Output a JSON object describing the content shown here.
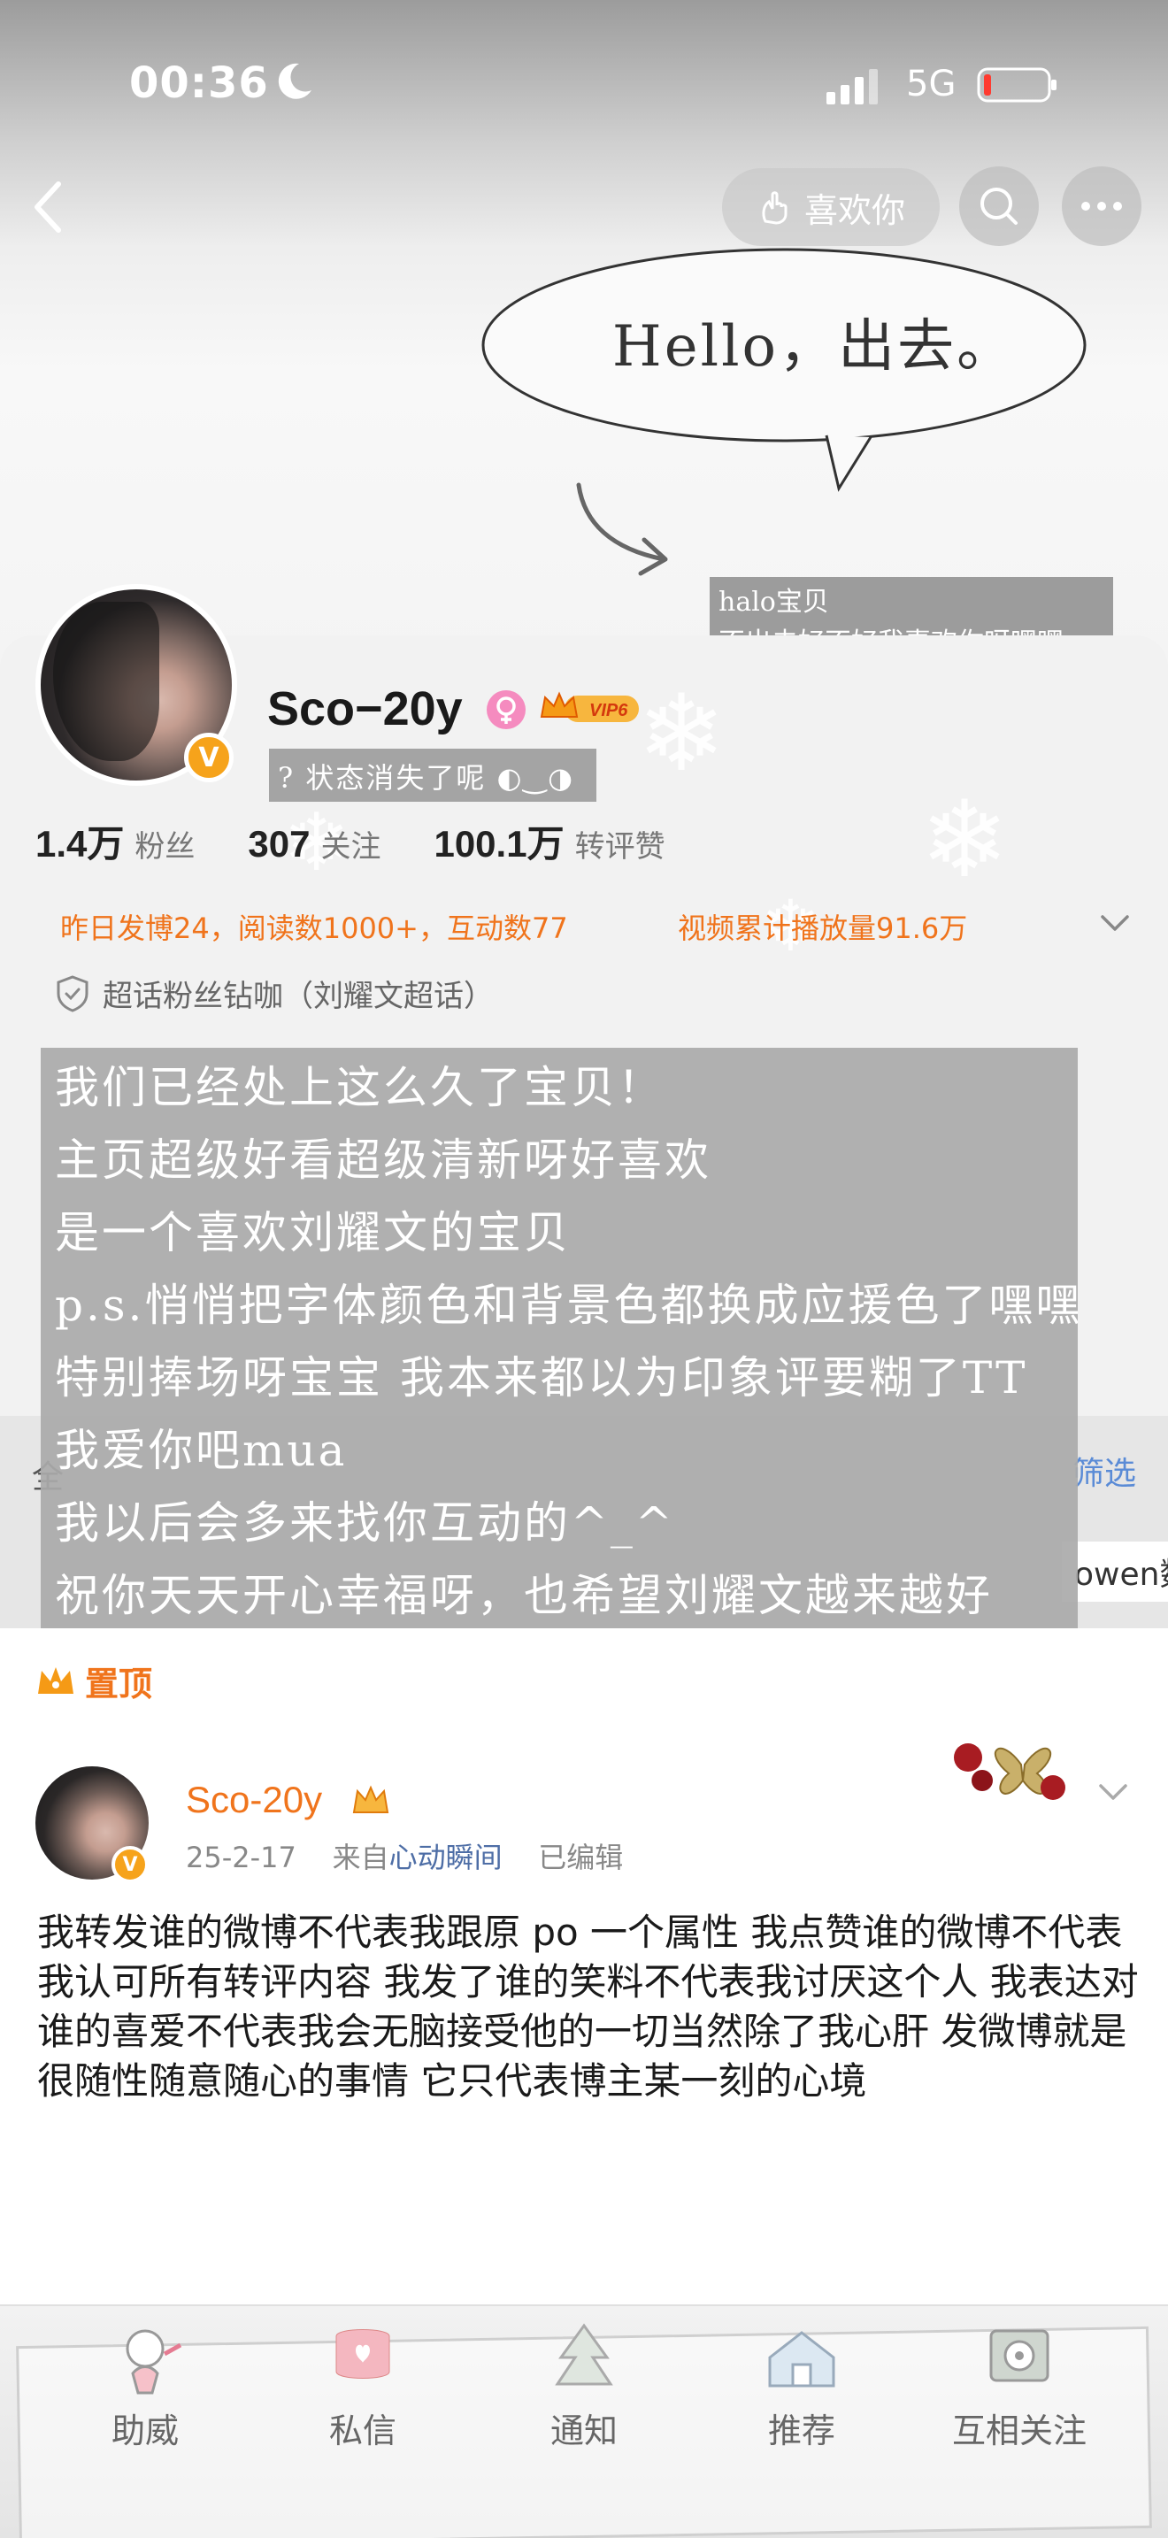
{
  "status_bar": {
    "time": "00:36",
    "network": "5G"
  },
  "header": {
    "like_button": "喜欢你"
  },
  "banner": {
    "bubble_text": "Hello，出去。",
    "note_line1": "halo宝贝",
    "note_line2": "不出去好不好我喜欢你呀嘿嘿"
  },
  "profile": {
    "username": "Sco−20y",
    "vip_label": "VIP6",
    "status_tag": "? 状态消失了呢 ◐‿◑",
    "stats": [
      {
        "num": "1.4万",
        "label": "粉丝"
      },
      {
        "num": "307",
        "label": "关注"
      },
      {
        "num": "100.1万",
        "label": "转评赞"
      }
    ],
    "activity": "昨日发博24，阅读数1000+，互动数77",
    "video_plays": "视频累计播放量91.6万",
    "super_topic": "超话粉丝钻咖（刘耀文超话）"
  },
  "bio_comment": {
    "lines": [
      "我们已经处上这么久了宝贝！",
      "主页超级好看超级清新呀好喜欢",
      "是一个喜欢刘耀文的宝贝",
      " p.s.悄悄把字体颜色和背景色都换成应援色了嘿嘿",
      "特别捧场呀宝宝 我本来都以为印象评要糊了TT",
      "我爱你吧mua",
      "我以后会多来找你互动的^_^",
      "祝你天天开心幸福呀，也希望刘耀文越来越好"
    ]
  },
  "partial_visible": {
    "filter": "筛选",
    "tag_fragment": "owen数",
    "left_fragment": "全"
  },
  "pinned": {
    "label": "置顶"
  },
  "post": {
    "author": "Sco-20y",
    "date": "25-2-17",
    "from_prefix": "来自",
    "source": "心动瞬间",
    "edited": "已编辑",
    "body": "我转发谁的微博不代表我跟原 po 一个属性 我点赞谁的微博不代表我认可所有转评内容 我发了谁的笑料不代表我讨厌这个人 我表达对谁的喜爱不代表我会无脑接受他的一切当然除了我心肝 发微博就是很随性随意随心的事情 它只代表博主某一刻的心境"
  },
  "tabbar": {
    "items": [
      {
        "label": "助威",
        "icon": "cheer-icon"
      },
      {
        "label": "私信",
        "icon": "message-icon"
      },
      {
        "label": "通知",
        "icon": "notification-icon"
      },
      {
        "label": "推荐",
        "icon": "recommend-icon"
      },
      {
        "label": "互相关注",
        "icon": "mutual-follow-icon"
      }
    ]
  },
  "colors": {
    "accent": "#f0741c",
    "link": "#4e6ea6",
    "vip": "#f6a31b"
  }
}
